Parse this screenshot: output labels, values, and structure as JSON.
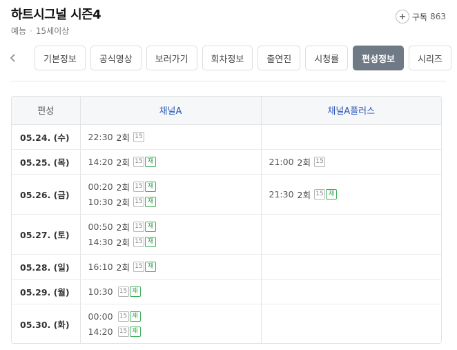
{
  "program": {
    "title": "하트시그널 시즌4",
    "genre": "예능",
    "separator": "·",
    "rating": "15세이상"
  },
  "subscribe": {
    "label": "구독",
    "count": "863"
  },
  "tabs": [
    {
      "label": "기본정보",
      "active": false
    },
    {
      "label": "공식영상",
      "active": false
    },
    {
      "label": "보러가기",
      "active": false
    },
    {
      "label": "회차정보",
      "active": false
    },
    {
      "label": "출연진",
      "active": false
    },
    {
      "label": "시청률",
      "active": false
    },
    {
      "label": "편성정보",
      "active": true
    },
    {
      "label": "시리즈",
      "active": false
    }
  ],
  "schedule": {
    "headers": {
      "date": "편성",
      "channel_a": "채널A",
      "channel_b": "채널A플러스"
    },
    "rows": [
      {
        "date": "05.24. (수)",
        "channel_a": [
          {
            "time": "22:30",
            "episode": "2회",
            "age": "15",
            "rerun": ""
          }
        ],
        "channel_b": []
      },
      {
        "date": "05.25. (목)",
        "channel_a": [
          {
            "time": "14:20",
            "episode": "2회",
            "age": "15",
            "rerun": "재"
          }
        ],
        "channel_b": [
          {
            "time": "21:00",
            "episode": "2회",
            "age": "15",
            "rerun": ""
          }
        ]
      },
      {
        "date": "05.26. (금)",
        "channel_a": [
          {
            "time": "00:20",
            "episode": "2회",
            "age": "15",
            "rerun": "재"
          },
          {
            "time": "10:30",
            "episode": "2회",
            "age": "15",
            "rerun": "재"
          }
        ],
        "channel_b": [
          {
            "time": "21:30",
            "episode": "2회",
            "age": "15",
            "rerun": "재"
          }
        ]
      },
      {
        "date": "05.27. (토)",
        "channel_a": [
          {
            "time": "00:50",
            "episode": "2회",
            "age": "15",
            "rerun": "재"
          },
          {
            "time": "14:30",
            "episode": "2회",
            "age": "15",
            "rerun": "재"
          }
        ],
        "channel_b": []
      },
      {
        "date": "05.28. (일)",
        "channel_a": [
          {
            "time": "16:10",
            "episode": "2회",
            "age": "15",
            "rerun": "재"
          }
        ],
        "channel_b": []
      },
      {
        "date": "05.29. (월)",
        "channel_a": [
          {
            "time": "10:30",
            "episode": "",
            "age": "15",
            "rerun": "재"
          }
        ],
        "channel_b": []
      },
      {
        "date": "05.30. (화)",
        "channel_a": [
          {
            "time": "00:00",
            "episode": "",
            "age": "15",
            "rerun": "재"
          },
          {
            "time": "14:20",
            "episode": "",
            "age": "15",
            "rerun": "재"
          }
        ],
        "channel_b": []
      }
    ]
  },
  "icons": {
    "subscribe": "plus-circle-icon",
    "prev": "chevron-left-icon"
  },
  "colors": {
    "active_tab_bg": "#707a86",
    "channel_header": "#2b56b8",
    "rerun_badge": "#3cb05a"
  }
}
